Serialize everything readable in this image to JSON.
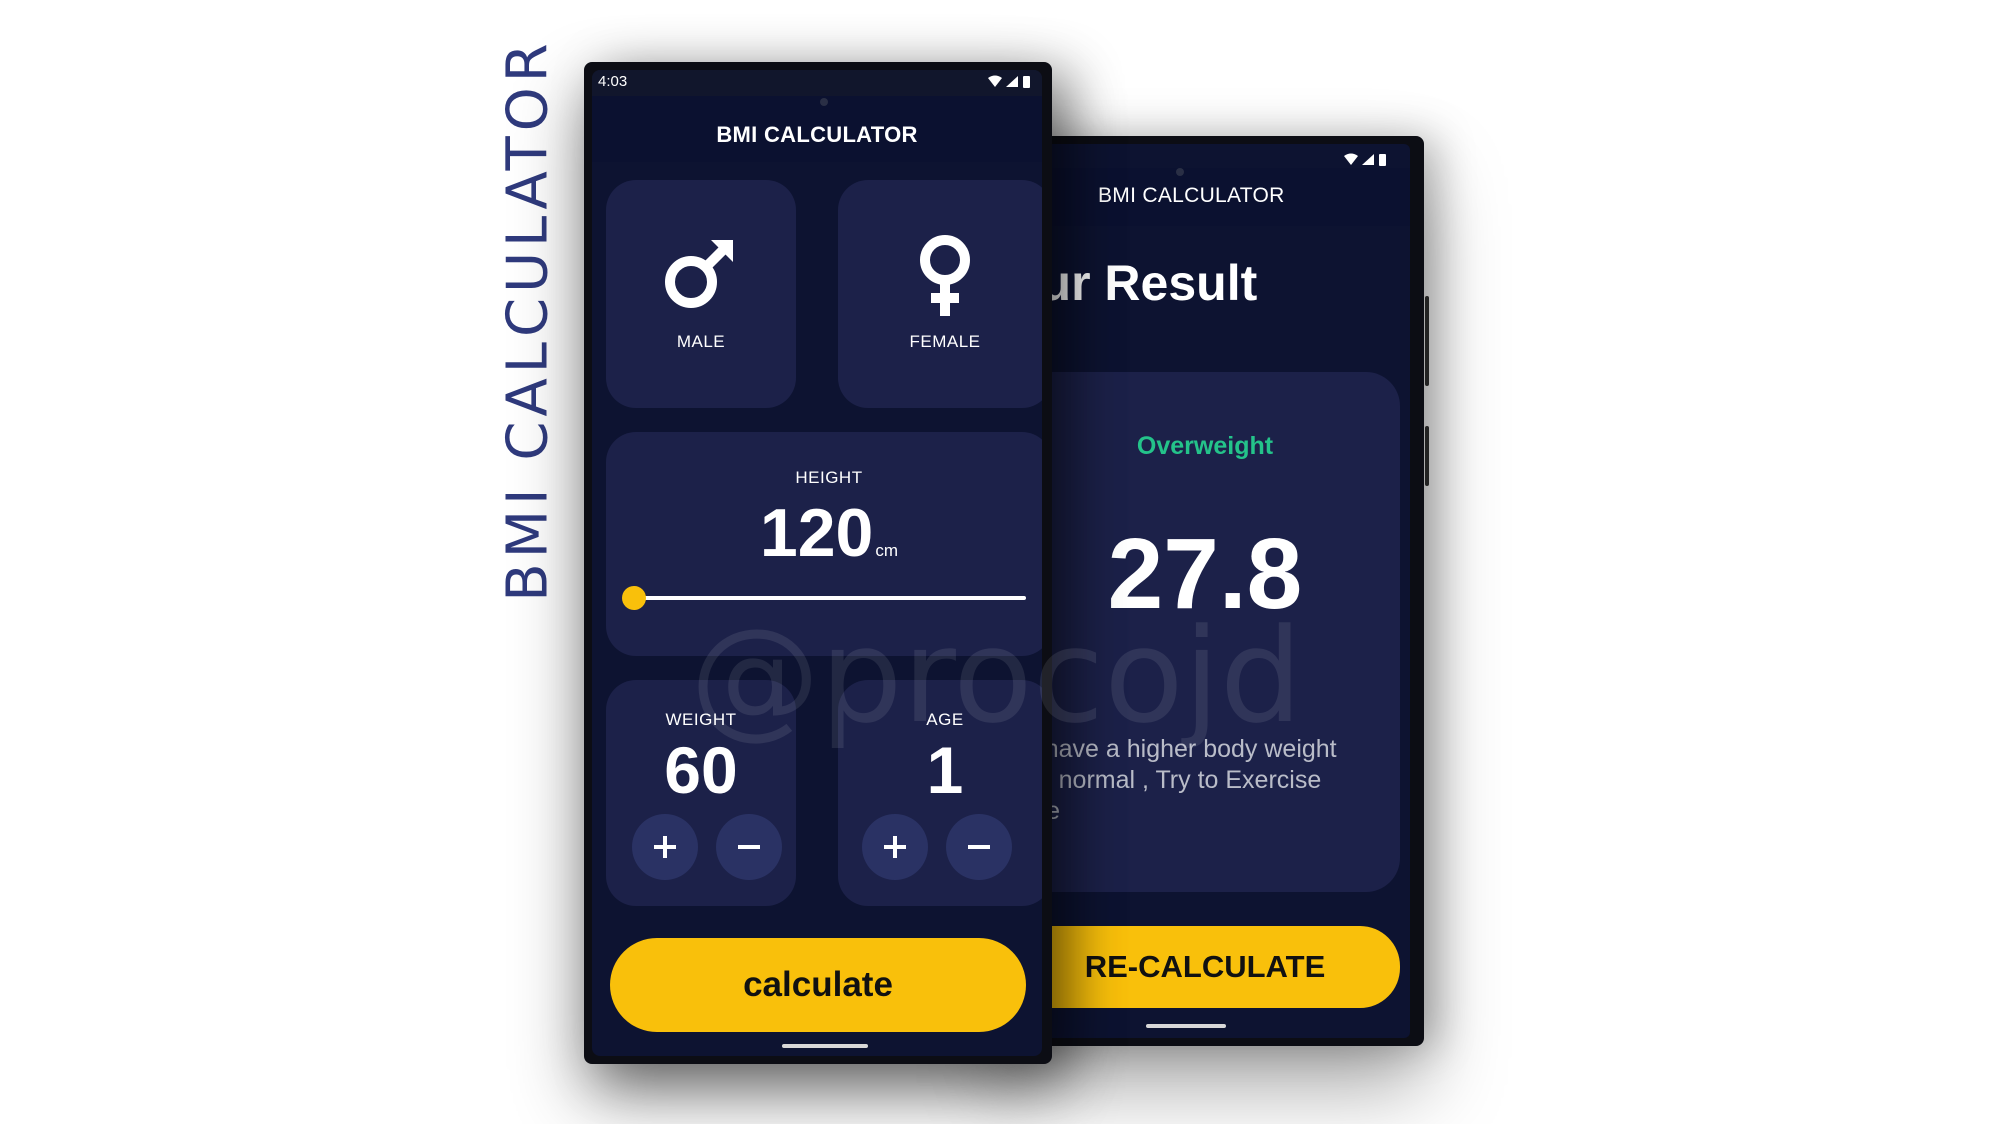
{
  "side_title": "BMI CALCULATOR",
  "watermark": "@procojd",
  "front": {
    "status_time": "4:03",
    "app_title": "BMI CALCULATOR",
    "gender": {
      "male_label": "MALE",
      "female_label": "FEMALE",
      "male_icon": "male-symbol-icon",
      "female_icon": "female-symbol-icon"
    },
    "height": {
      "label": "HEIGHT",
      "value": "120",
      "unit": "cm",
      "slider_fraction": 0.0
    },
    "weight": {
      "label": "WEIGHT",
      "value": "60"
    },
    "age": {
      "label": "AGE",
      "value": "1"
    },
    "calculate_label": "calculate"
  },
  "back": {
    "app_title": "BMI CALCULATOR",
    "heading": "our Result",
    "status": "Overweight",
    "bmi_value": "27.8",
    "message": "ou have a higher body weight\nhan normal , Try to Exercise\nnore",
    "recalculate_label": "RE-CALCULATE"
  },
  "colors": {
    "background": "#0d1331",
    "card": "#1c2149",
    "accent": "#f9c00b",
    "status_green": "#24c38a",
    "side_title": "#2f3a7d"
  }
}
